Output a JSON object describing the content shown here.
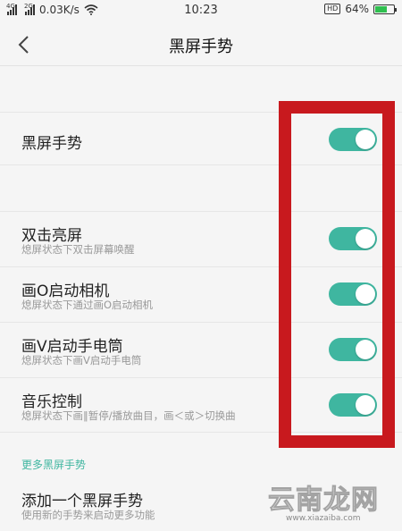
{
  "status_bar": {
    "signal_1_tag": "4G",
    "signal_2_tag": "2G",
    "speed": "0.03K/s",
    "time": "10:23",
    "hd_badge": "HD",
    "battery_percent": "64%",
    "battery_level": 0.64,
    "battery_color": "#2fbf4f"
  },
  "header": {
    "title": "黑屏手势",
    "back_icon": "chevron-left-icon"
  },
  "main_toggle": {
    "label": "黑屏手势",
    "enabled": true
  },
  "gestures": [
    {
      "title": "双击亮屏",
      "subtitle": "熄屏状态下双击屏幕唤醒",
      "enabled": true
    },
    {
      "title": "画O启动相机",
      "subtitle": "熄屏状态下通过画O启动相机",
      "enabled": true
    },
    {
      "title": "画V启动手电筒",
      "subtitle": "熄屏状态下画V启动手电筒",
      "enabled": true
    },
    {
      "title": "音乐控制",
      "subtitle": "熄屏状态下画‖暂停/播放曲目，画＜或＞切换曲",
      "enabled": true
    }
  ],
  "more_section": {
    "label": "更多黑屏手势",
    "add_title": "添加一个黑屏手势",
    "add_subtitle": "使用新的手势来启动更多功能"
  },
  "watermark": {
    "main": "云南龙网",
    "sub": "www.xiazaiba.com"
  },
  "colors": {
    "accent": "#3fb6a0",
    "highlight_frame": "#c8191e",
    "background": "#f5f5f5"
  }
}
